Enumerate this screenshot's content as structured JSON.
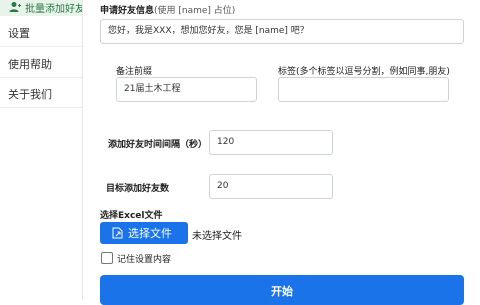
{
  "sidebar": {
    "header": "批量添加好友",
    "items": [
      {
        "label": "设置"
      },
      {
        "label": "使用帮助"
      },
      {
        "label": "关于我们"
      }
    ]
  },
  "form": {
    "greeting_label": "申请好友信息",
    "greeting_hint": "(使用 [name] 占位)",
    "greeting_value": "您好，我是XXX，想加您好友，您是 [name] 吧？",
    "remark_label": "备注前缀",
    "remark_value": "21届土木工程",
    "tags_label": "标签(多个标签以逗号分割，例如同事,朋友)",
    "tags_value": "",
    "interval_label": "添加好友时间间隔（秒）",
    "interval_value": "120",
    "target_label": "目标添加好友数",
    "target_value": "20",
    "excel_label": "选择Excel文件",
    "choose_file_label": "选择文件",
    "no_file_text": "未选择文件",
    "remember_label": "记住设置内容",
    "remember_checked": false,
    "start_label": "开始"
  },
  "colors": {
    "primary": "#1a73e8",
    "sidebar_accent": "#2a7a45"
  }
}
